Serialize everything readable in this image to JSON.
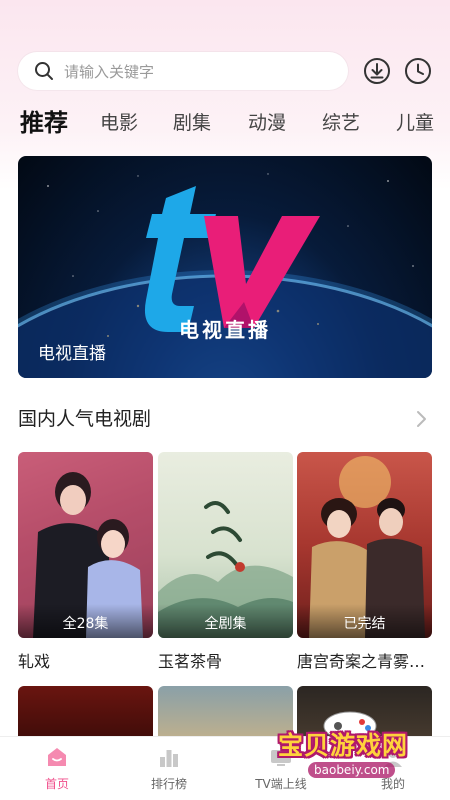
{
  "search": {
    "placeholder": "请输入关键字"
  },
  "header_icons": {
    "download": "download-icon",
    "history": "clock-icon"
  },
  "tabs": [
    "推荐",
    "电影",
    "剧集",
    "动漫",
    "综艺",
    "儿童"
  ],
  "active_tab": "推荐",
  "banner": {
    "logo_text": "tv",
    "center_title": "电视直播",
    "caption": "电视直播"
  },
  "section": {
    "title": "国内人气电视剧"
  },
  "cards": [
    {
      "title": "轧戏",
      "badge": "全28集"
    },
    {
      "title": "玉茗茶骨",
      "badge": "全剧集"
    },
    {
      "title": "唐宫奇案之青雾…",
      "badge": "已完结"
    }
  ],
  "bottom_nav": [
    {
      "label": "首页",
      "icon": "home-icon",
      "active": true
    },
    {
      "label": "排行榜",
      "icon": "bar-chart-icon",
      "active": false
    },
    {
      "label": "TV端上线",
      "icon": "tv-icon",
      "active": false
    },
    {
      "label": "我的",
      "icon": "user-icon",
      "active": false
    }
  ],
  "watermark": {
    "text": "宝贝游戏网",
    "url": "baobeiy.com"
  },
  "colors": {
    "accent": "#f0508c",
    "banner_cyan": "#1ea8e8",
    "banner_magenta": "#e91e78"
  }
}
